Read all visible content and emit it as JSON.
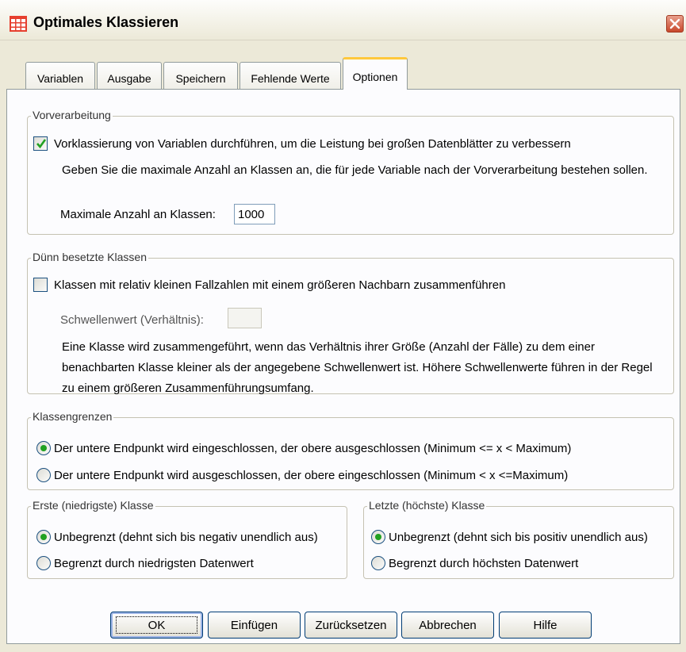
{
  "window": {
    "title": "Optimales Klassieren"
  },
  "tabs": [
    {
      "label": "Variablen"
    },
    {
      "label": "Ausgabe"
    },
    {
      "label": "Speichern"
    },
    {
      "label": "Fehlende Werte"
    },
    {
      "label": "Optionen",
      "active": true
    }
  ],
  "preprocessing": {
    "legend": "Vorverarbeitung",
    "checkbox_label": "Vorklassierung von Variablen durchführen, um die Leistung bei großen Datenblätter zu verbessern",
    "checked": true,
    "description": "Geben Sie die maximale Anzahl an Klassen an, die für jede Variable nach der Vorverarbeitung bestehen sollen.",
    "max_label": "Maximale Anzahl an Klassen:",
    "max_value": "1000"
  },
  "sparse": {
    "legend": "Dünn besetzte Klassen",
    "checkbox_label": "Klassen mit relativ kleinen Fallzahlen mit einem größeren Nachbarn zusammenführen",
    "checked": false,
    "threshold_label": "Schwellenwert (Verhältnis):",
    "threshold_value": "",
    "description": "Eine Klasse wird zusammengeführt, wenn das Verhältnis ihrer Größe (Anzahl der Fälle) zu dem einer benachbarten Klasse kleiner als der angegebene Schwellenwert ist. Höhere Schwellenwerte führen in der Regel zu einem größeren Zusammenführungsumfang."
  },
  "bounds": {
    "legend": "Klassengrenzen",
    "options": [
      {
        "label": "Der untere Endpunkt wird eingeschlossen, der obere ausgeschlossen (Minimum <= x < Maximum)",
        "selected": true
      },
      {
        "label": "Der untere Endpunkt wird ausgeschlossen, der obere eingeschlossen (Minimum < x <=Maximum)",
        "selected": false
      }
    ]
  },
  "first_bin": {
    "legend": "Erste (niedrigste) Klasse",
    "options": [
      {
        "label": "Unbegrenzt (dehnt sich bis negativ unendlich aus)",
        "selected": true
      },
      {
        "label": "Begrenzt durch niedrigsten Datenwert",
        "selected": false
      }
    ]
  },
  "last_bin": {
    "legend": "Letzte (höchste) Klasse",
    "options": [
      {
        "label": "Unbegrenzt (dehnt sich bis positiv unendlich aus)",
        "selected": true
      },
      {
        "label": "Begrenzt durch höchsten Datenwert",
        "selected": false
      }
    ]
  },
  "buttons": {
    "ok": "OK",
    "paste": "Einfügen",
    "reset": "Zurücksetzen",
    "cancel": "Abbrechen",
    "help": "Hilfe"
  },
  "colors": {
    "active_tab_accent": "#ffc83c",
    "radio_dot": "#21a121",
    "close_button": "#c8482b"
  }
}
